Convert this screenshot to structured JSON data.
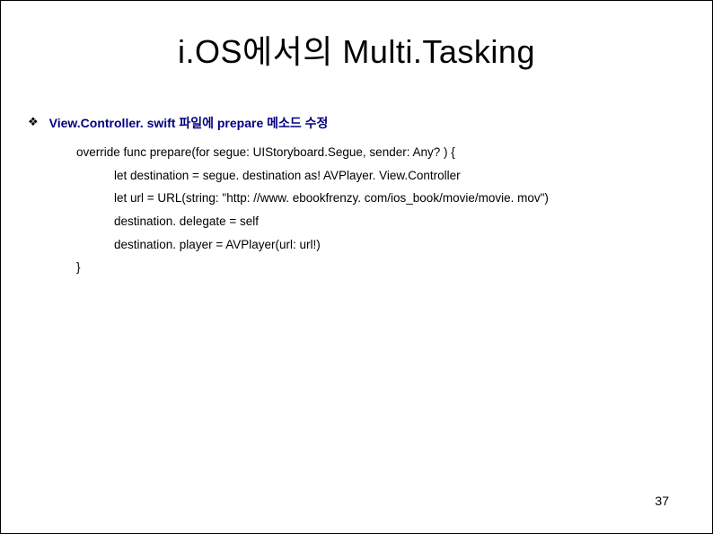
{
  "title": "i.OS에서의 Multi.Tasking",
  "bullet": {
    "label": "View.Controller. swift 파일에 prepare 메소드 수정"
  },
  "code": {
    "line1": "override func prepare(for segue: UIStoryboard.Segue, sender: Any? ) {",
    "line2": "let destination = segue. destination as! AVPlayer. View.Controller",
    "line3": "let url = URL(string: \"http: //www. ebookfrenzy. com/ios_book/movie/movie. mov\")",
    "line4": "destination. delegate = self",
    "line5": "destination. player = AVPlayer(url: url!)",
    "line6": "}"
  },
  "pageNumber": "37"
}
